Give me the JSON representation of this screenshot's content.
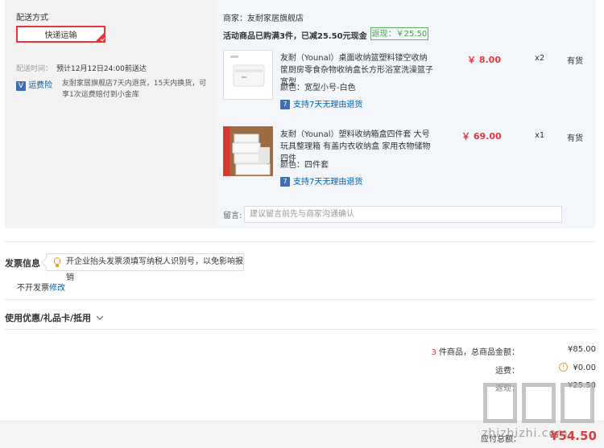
{
  "shipping": {
    "title": "配送方式",
    "method_button": "快递运输",
    "time_label": "配送时间：",
    "time_value": "预计12月12日24:00前送达",
    "insurance_badge": "V",
    "insurance_label": "运费险",
    "insurance_desc": "友耐家居旗舰店7天内退货，15天内换货，可享1次运费赔付到小金库"
  },
  "shop": {
    "merchant_label": "商家：友耐家居旗舰店",
    "promo_text": "活动商品已购满3件，已减25.50元现金",
    "rebate": "返现：￥25.50",
    "items": [
      {
        "title": "友耐（Younal）桌面收纳篮塑料镂空收纳筐厨房零食杂物收纳盒长方形浴室洗澡篮子 宽型",
        "color": "颜色：宽型小号-白色",
        "price": "￥ 8.00",
        "qty": "x2",
        "stock": "有货",
        "return_policy": "支持7天无理由退货"
      },
      {
        "title": "友耐（Younal）塑料收纳箱盒四件套 大号玩具整理箱 有盖内衣收纳盒 家用衣物储物 四件",
        "color": "颜色：四件套",
        "price": "￥ 69.00",
        "qty": "x1",
        "stock": "有货",
        "return_policy": "支持7天无理由退货"
      }
    ],
    "message_label": "留言:",
    "message_placeholder": "建议留言前先与商家沟通确认"
  },
  "invoice": {
    "title": "发票信息",
    "tip": "开企业抬头发票须填写纳税人识别号，以免影响报销",
    "value": "不开发票",
    "edit_link": "修改"
  },
  "discount": {
    "title": "使用优惠/礼品卡/抵用"
  },
  "summary": {
    "count": "3",
    "count_suffix": "件商品，总商品金额：",
    "total_amount": "¥85.00",
    "shipping_label": "运费：",
    "shipping_value": "¥0.00",
    "rebate_label": "返现：",
    "rebate_value": "¥25.50",
    "payable_label": "应付总额：",
    "payable_value": "¥54.50"
  },
  "watermark": "zhizhizhi.com",
  "colors": {
    "accent": "#e4393c",
    "link": "#005ea7",
    "rebate_green": "#4a9d4a"
  }
}
